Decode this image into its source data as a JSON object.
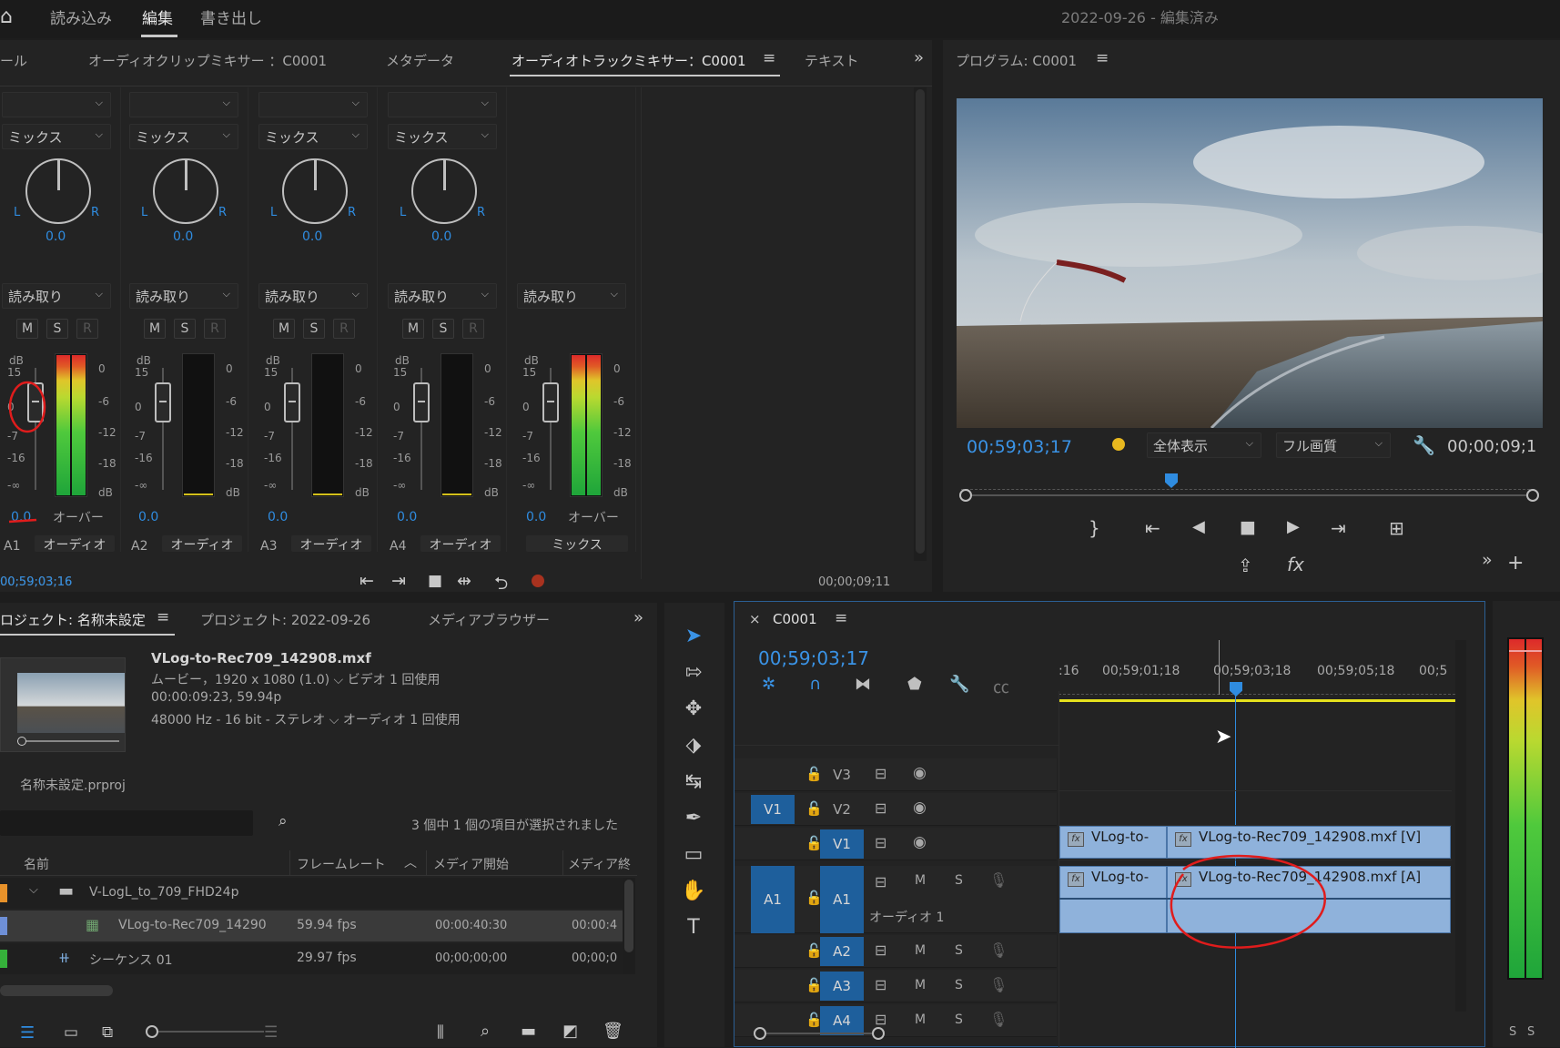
{
  "workspace": {
    "tabs": [
      "読み込み",
      "編集",
      "書き出し"
    ],
    "active": "編集",
    "title": "2022-09-26",
    "title_suffix": " - 編集済み"
  },
  "mixer": {
    "tabs": [
      "ール",
      "オーディオクリップミキサー ：C0001",
      "メタデータ",
      "オーディオトラックミキサー：C0001",
      "テキスト"
    ],
    "active_tab": "オーディオトラックミキサー：C0001",
    "channels": [
      {
        "mix": "ミックス",
        "pan_value": "0.0",
        "auto": "読み取り",
        "vol": "0.0",
        "track": "A1",
        "out": "オーディオ",
        "over": "オーバー"
      },
      {
        "mix": "ミックス",
        "pan_value": "0.0",
        "auto": "読み取り",
        "vol": "0.0",
        "track": "A2",
        "out": "オーディオ"
      },
      {
        "mix": "ミックス",
        "pan_value": "0.0",
        "auto": "読み取り",
        "vol": "0.0",
        "track": "A3",
        "out": "オーディオ"
      },
      {
        "mix": "ミックス",
        "pan_value": "0.0",
        "auto": "読み取り",
        "vol": "0.0",
        "track": "A4",
        "out": "オーディオ"
      }
    ],
    "master": {
      "auto": "読み取り",
      "vol": "0.0",
      "over": "オーバー",
      "out": "ミックス"
    },
    "L": "L",
    "R": "R",
    "M": "M",
    "S": "S",
    "Rb": "R",
    "db_label": "dB",
    "fader_scale": [
      "15",
      "0",
      "-7",
      "-16",
      "-∞"
    ],
    "meter_scale": [
      "0",
      "-6",
      "-12",
      "-18",
      "dB"
    ],
    "time_left": "00;59;03;16",
    "time_right": "00;00;09;11"
  },
  "program": {
    "title": "プログラム: C0001",
    "timecode": "00;59;03;17",
    "zoom": "全体表示",
    "quality": "フル画質",
    "duration": "00;00;09;1"
  },
  "project": {
    "tabs": [
      "ロジェクト: 名称未設定",
      "プロジェクト: 2022-09-26",
      "メディアブラウザー"
    ],
    "clip_name": "VLog-to-Rec709_142908.mxf",
    "info1": "ムービー，1920 x 1080 (1.0)",
    "info1b": "ビデオ 1 回使用",
    "info2": "00:00:09:23, 59.94p",
    "info3": "48000 Hz - 16 bit - ステレオ",
    "info3b": "オーディオ 1 回使用",
    "file": "名称未設定.prproj",
    "selection": "3 個中 1 個の項目が選択されました",
    "columns": [
      "名前",
      "フレームレート",
      "メディア開始",
      "メディア終"
    ],
    "rows": [
      {
        "name": "V-LogL_to_709_FHD24p",
        "fps": "",
        "start": "",
        "end": "",
        "color": "#e8922a"
      },
      {
        "name": "VLog-to-Rec709_14290",
        "fps": "59.94 fps",
        "start": "00:00:40:30",
        "end": "00:00:4",
        "color": "#6e8fd6"
      },
      {
        "name": "シーケンス 01",
        "fps": "29.97 fps",
        "start": "00;00;00;00",
        "end": "00;00;0",
        "color": "#35b03a"
      }
    ]
  },
  "timeline": {
    "seq": "C0001",
    "timecode": "00;59;03;17",
    "ruler": [
      ":16",
      "00;59;01;18",
      "00;59;03;18",
      "00;59;05;18",
      "00;5"
    ],
    "tracks_v": [
      "V3",
      "V2",
      "V1"
    ],
    "src_v": "V1",
    "tracks_a": [
      "A1",
      "A2",
      "A3",
      "A4"
    ],
    "src_a": "A1",
    "audio_name": "オーディオ 1",
    "clip_v_short": "VLog-to-",
    "clip_v": "VLog-to-Rec709_142908.mxf [V]",
    "clip_a_short": "VLog-to-",
    "clip_a": "VLog-to-Rec709_142908.mxf [A]",
    "M": "M",
    "S": "S"
  },
  "master_meter": {
    "s1": "S",
    "s2": "S"
  }
}
